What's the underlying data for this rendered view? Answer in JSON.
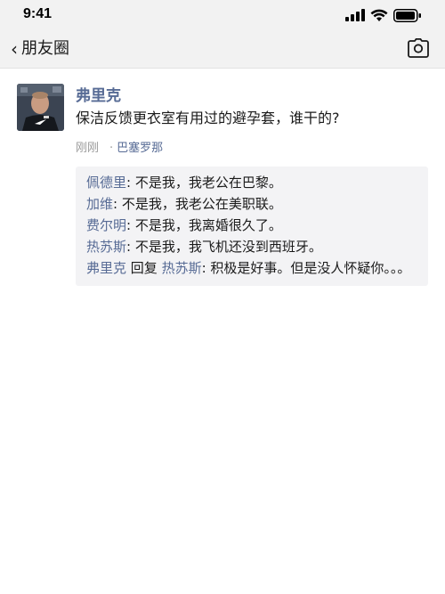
{
  "status_bar": {
    "time": "9:41"
  },
  "nav": {
    "title": "朋友圈",
    "back_icon": "chevron-left-icon",
    "camera_icon": "camera-icon"
  },
  "post": {
    "author": "弗里克",
    "text": "保洁反馈更衣室有用过的避孕套，谁干的?",
    "time": "刚刚",
    "location_sep": "·",
    "location": "巴塞罗那",
    "comments": [
      {
        "name": "佩德里",
        "sep": ": ",
        "text": "不是我，我老公在巴黎。"
      },
      {
        "name": "加维",
        "sep": ": ",
        "text": "不是我，我老公在美职联。"
      },
      {
        "name": "费尔明",
        "sep": ": ",
        "text": "不是我，我离婚很久了。"
      },
      {
        "name": "热苏斯",
        "sep": ": ",
        "text": "不是我，我飞机还没到西班牙。"
      }
    ],
    "reply": {
      "name": "弗里克",
      "reply_word": " 回复 ",
      "target": "热苏斯",
      "sep": ": ",
      "text": "积极是好事。但是没人怀疑你。。。"
    }
  },
  "colors": {
    "link": "#576b95",
    "bar_bg": "#f2f2f2",
    "comment_bg": "#f3f3f5"
  }
}
